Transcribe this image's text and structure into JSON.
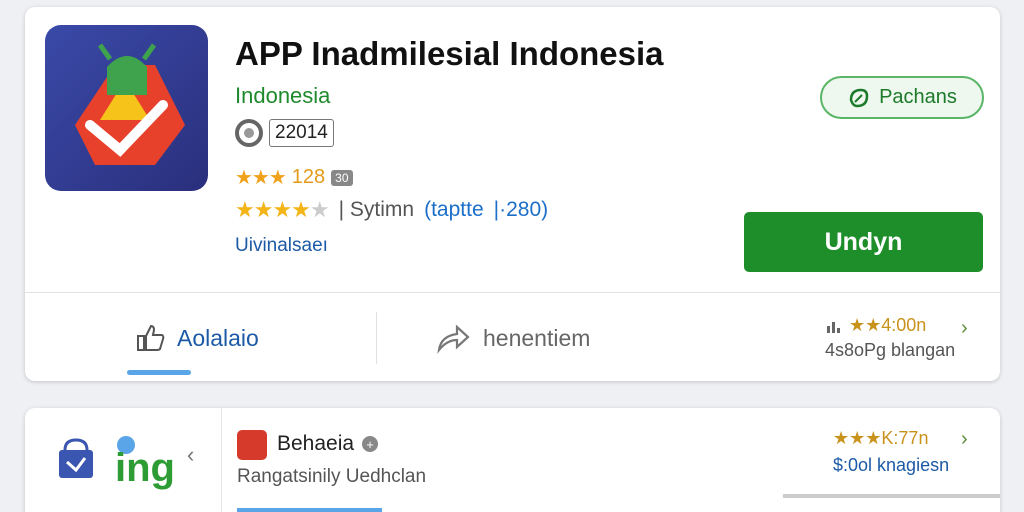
{
  "app": {
    "title": "APP Inadmilesial Indonesia",
    "developer": "Indonesia",
    "version": "22014",
    "rating_small": "★★★",
    "rating_small_value": "128",
    "rating_small_badge": "30",
    "rating_stars": "★★★★",
    "rating_stars_empty": "★",
    "rating_text": "| Sytimn",
    "rating_link": "(taptte",
    "rating_count": "|·280)",
    "sub_link": "Uivinalsaeı"
  },
  "buttons": {
    "purchase_label": "Pachans",
    "install_label": "Undyn"
  },
  "actions": {
    "like_label": "Aolalaio",
    "share_label": "henentiem"
  },
  "stats": {
    "rating": "★★4:00n",
    "downloads": "4s8oPg blangan"
  },
  "related": {
    "brand": "ing",
    "app_name": "Behaeia",
    "app_sub": "Rangatsinily Uedhclan",
    "rating": "★★★K:77n",
    "price": "$:0ol knagiesn"
  },
  "colors": {
    "accent_green": "#1e8e2a",
    "link_blue": "#1c6fc9",
    "star_yellow": "#f3b418"
  },
  "icons": {
    "app": "android-app-icon",
    "version": "circle-icon",
    "purchase": "leaf-icon",
    "like": "thumbs-up-icon",
    "share": "share-arrow-icon",
    "chevron": "chevron-right-icon"
  }
}
